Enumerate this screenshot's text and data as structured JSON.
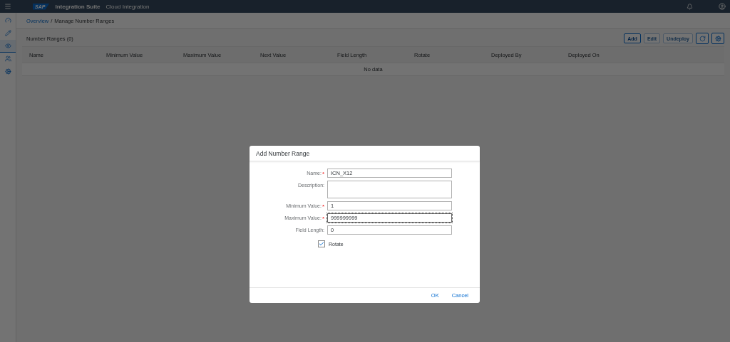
{
  "shell": {
    "logo": "SAP",
    "product": "Integration Suite",
    "area": "Cloud Integration"
  },
  "sidebar": {
    "items": [
      {
        "selected": false
      },
      {
        "selected": false
      },
      {
        "selected": true
      },
      {
        "selected": false
      },
      {
        "selected": false
      }
    ]
  },
  "breadcrumb": {
    "link": "Overview",
    "separator": "/",
    "current": "Manage Number Ranges"
  },
  "toolbar": {
    "title": "Number Ranges (0)",
    "buttons": [
      {
        "label": "Add",
        "disabled": false
      },
      {
        "label": "Edit",
        "disabled": true
      },
      {
        "label": "Undeploy",
        "disabled": true
      }
    ]
  },
  "table": {
    "columns": [
      "Name",
      "Minimum Value",
      "Maximum Value",
      "Next Value",
      "Field Length",
      "Rotate",
      "Deployed By",
      "Deployed On"
    ],
    "empty_text": "No data"
  },
  "dialog": {
    "title": "Add Number Range",
    "fields": [
      {
        "label": "Name:",
        "required_mark": "*",
        "value": "ICN_X12",
        "kind": "input"
      },
      {
        "label": "Description:",
        "kind": "textarea"
      },
      {
        "label": "Minimum Value:",
        "required_mark": "*",
        "value": "1",
        "kind": "input"
      },
      {
        "label": "Maximum Value:",
        "required_mark": "*",
        "value": "999999999",
        "kind": "input",
        "focused": true
      },
      {
        "label": "Field Length:",
        "value": "0",
        "kind": "input"
      }
    ],
    "checkbox": {
      "label": "Rotate",
      "checked": true
    },
    "buttons": [
      "OK",
      "Cancel"
    ]
  }
}
